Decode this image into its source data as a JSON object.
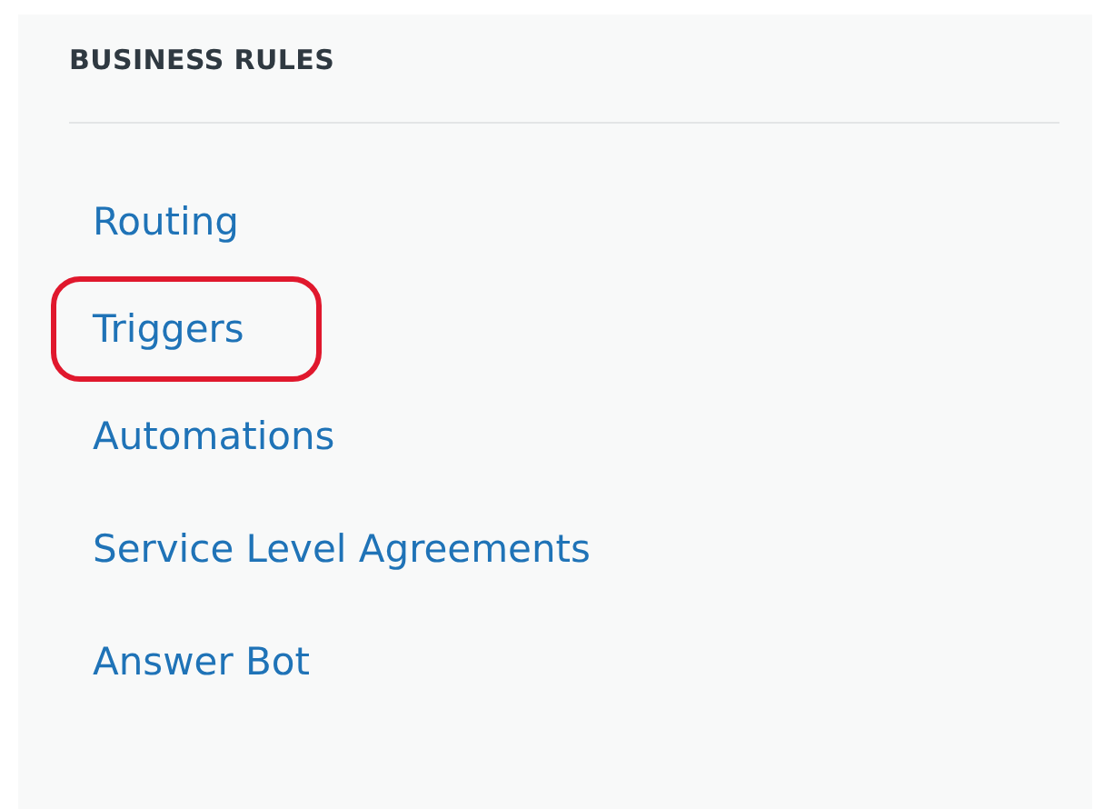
{
  "section": {
    "title": "BUSINESS RULES"
  },
  "items": [
    {
      "label": "Routing",
      "highlighted": false
    },
    {
      "label": "Triggers",
      "highlighted": true
    },
    {
      "label": "Automations",
      "highlighted": false
    },
    {
      "label": "Service Level Agreements",
      "highlighted": false
    },
    {
      "label": "Answer Bot",
      "highlighted": false
    }
  ]
}
